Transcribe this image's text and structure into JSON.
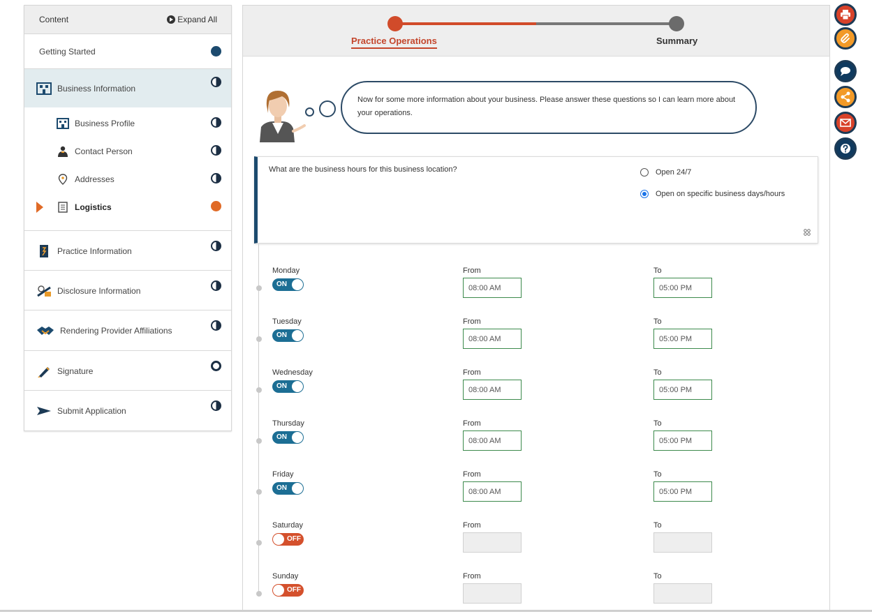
{
  "sidebar": {
    "header": {
      "title": "Content",
      "expand_all": "Expand All"
    },
    "getting_started": "Getting Started",
    "business_information": "Business Information",
    "sub_items": [
      "Business Profile",
      "Contact Person",
      "Addresses",
      "Logistics"
    ],
    "sections": [
      "Practice Information",
      "Disclosure Information",
      "Rendering Provider Affiliations",
      "Signature",
      "Submit Application"
    ]
  },
  "progress": {
    "step1": "Practice Operations",
    "step2": "Summary"
  },
  "assistant": {
    "message": "Now for some more information about your business. Please answer these questions so I can learn more about your operations."
  },
  "question": {
    "text": "What are the business hours for this business location?",
    "options": [
      "Open 24/7",
      "Open on specific business days/hours"
    ],
    "selected": 1
  },
  "hours": {
    "from_label": "From",
    "to_label": "To",
    "on_label": "ON",
    "off_label": "OFF",
    "days": [
      {
        "name": "Monday",
        "enabled": true,
        "from": "08:00 AM",
        "to": "05:00 PM"
      },
      {
        "name": "Tuesday",
        "enabled": true,
        "from": "08:00 AM",
        "to": "05:00 PM"
      },
      {
        "name": "Wednesday",
        "enabled": true,
        "from": "08:00 AM",
        "to": "05:00 PM"
      },
      {
        "name": "Thursday",
        "enabled": true,
        "from": "08:00 AM",
        "to": "05:00 PM"
      },
      {
        "name": "Friday",
        "enabled": true,
        "from": "08:00 AM",
        "to": "05:00 PM"
      },
      {
        "name": "Saturday",
        "enabled": false,
        "from": "",
        "to": ""
      },
      {
        "name": "Sunday",
        "enabled": false,
        "from": "",
        "to": ""
      }
    ]
  },
  "colors": {
    "accent": "#c4452b",
    "navy": "#1c4a6e",
    "toggle_on": "#1c6e94",
    "toggle_off": "#d4502c",
    "status_pending": "#e06a26"
  },
  "actions": [
    "print-icon",
    "attachment-icon",
    "chat-icon",
    "share-icon",
    "mail-icon",
    "help-icon"
  ]
}
